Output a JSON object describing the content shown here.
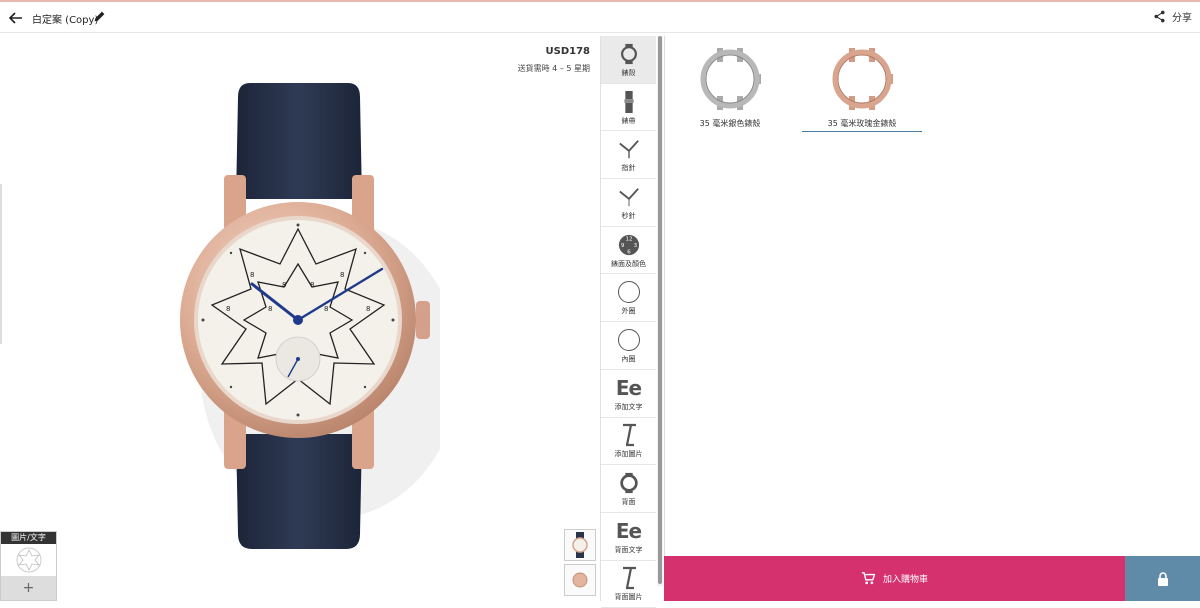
{
  "header": {
    "title": "白定案 (Copy)",
    "share_label": "分享"
  },
  "preview": {
    "price": "USD178",
    "shipping": "送貨需時 4 – 5 星期"
  },
  "image_text_panel": {
    "label": "圖片/文字",
    "add_symbol": "+"
  },
  "toolbar": {
    "items": [
      {
        "label": "錶殼",
        "icon": "watch-case-icon",
        "active": true
      },
      {
        "label": "錶帶",
        "icon": "strap-icon"
      },
      {
        "label": "指針",
        "icon": "hands-icon"
      },
      {
        "label": "秒針",
        "icon": "second-hand-icon"
      },
      {
        "label": "錶面及顏色",
        "icon": "dial-icon"
      },
      {
        "label": "外圈",
        "icon": "outer-ring-icon"
      },
      {
        "label": "內圈",
        "icon": "inner-ring-icon"
      },
      {
        "label": "添加文字",
        "icon": "add-text-icon",
        "glyph": "Ee"
      },
      {
        "label": "添加圖片",
        "icon": "add-image-icon"
      },
      {
        "label": "背面",
        "icon": "back-case-icon"
      },
      {
        "label": "背面文字",
        "icon": "back-text-icon",
        "glyph": "Ee"
      },
      {
        "label": "背面圖片",
        "icon": "back-image-icon"
      }
    ]
  },
  "options": [
    {
      "label": "35 毫米銀色錶殼",
      "color": "#b8b8b8",
      "selected": false
    },
    {
      "label": "35 毫米玫瑰金錶殼",
      "color": "#d9a58e",
      "selected": true
    }
  ],
  "cart": {
    "label": "加入購物車"
  },
  "colors": {
    "accent": "#d6316f",
    "lock_bg": "#5f8aa8",
    "strap": "#2a3449",
    "case": "#e0b5a0",
    "hands": "#1f3a8a"
  }
}
